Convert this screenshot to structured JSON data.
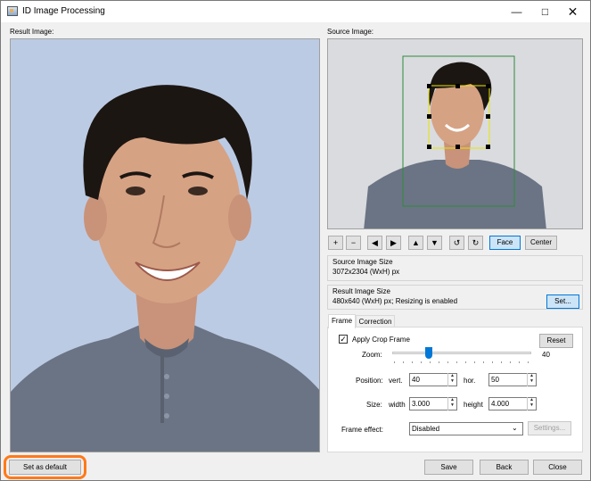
{
  "window": {
    "title": "ID Image Processing"
  },
  "labels": {
    "result_image": "Result Image:",
    "source_image": "Source Image:"
  },
  "toolbar": {
    "zoom_in": "+",
    "zoom_out": "−",
    "move_left": "◀",
    "move_right": "▶",
    "move_up": "▲",
    "move_down": "▼",
    "rotate_ccw": "↺",
    "rotate_cw": "↻",
    "face": "Face",
    "center": "Center"
  },
  "source_size": {
    "label": "Source Image Size",
    "value": "3072x2304 (WxH) px"
  },
  "result_size": {
    "label": "Result Image Size",
    "value": "480x640 (WxH) px; Resizing is enabled",
    "set_button": "Set..."
  },
  "tabs": {
    "frame": "Frame",
    "correction": "Correction"
  },
  "frame": {
    "apply_crop_label": "Apply Crop Frame",
    "apply_crop_checked": true,
    "reset": "Reset",
    "zoom_label": "Zoom:",
    "zoom_value": "40",
    "position_label": "Position:",
    "vert_label": "vert.",
    "vert_value": "40",
    "hor_label": "hor.",
    "hor_value": "50",
    "size_label": "Size:",
    "width_label": "width",
    "width_value": "3.000",
    "height_label": "height",
    "height_value": "4.000",
    "frame_effect_label": "Frame effect:",
    "frame_effect_value": "Disabled",
    "settings": "Settings..."
  },
  "footer": {
    "set_default": "Set as default",
    "save": "Save",
    "back": "Back",
    "close": "Close"
  },
  "colors": {
    "bg_photo": "#b8c8e2",
    "hair": "#1c1612",
    "skin": "#d4a081",
    "shirt": "#6b7484",
    "highlight": "#ff7a1a",
    "selected_btn": "#cce4f7"
  }
}
